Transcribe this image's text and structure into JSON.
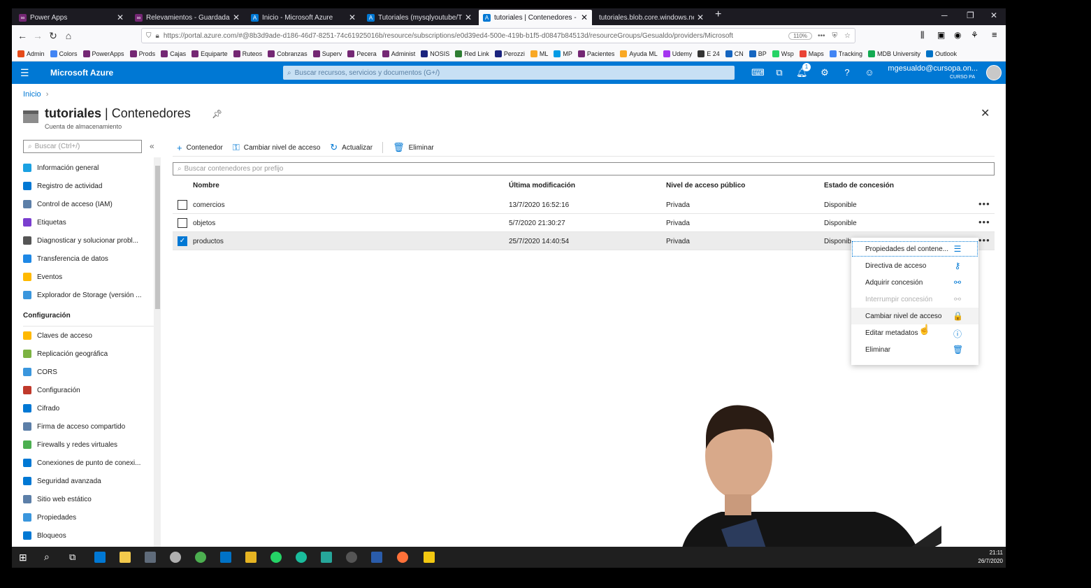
{
  "browser": {
    "tabs": [
      {
        "label": "Power Apps",
        "color": "#742774"
      },
      {
        "label": "Relevamientos - Guardada (no",
        "color": "#742774"
      },
      {
        "label": "Inicio - Microsoft Azure",
        "color": "#0078d4"
      },
      {
        "label": "Tutoriales (mysqlyoutube/Tuto",
        "color": "#0078d4"
      },
      {
        "label": "tutoriales | Contenedores - Mic",
        "color": "#0078d4"
      },
      {
        "label": "tutoriales.blob.core.windows.net/p",
        "color": "#888888"
      }
    ],
    "new_tab": "+",
    "url": "https://portal.azure.com/#@8b3d9ade-d186-46d7-8251-74c61925016b/resource/subscriptions/e0d39ed4-500e-419b-b1f5-d0847b84513d/resourceGroups/Gesualdo/providers/Microsoft",
    "zoom": "110%",
    "bookmarks": [
      {
        "label": "Admin",
        "color": "#e64a19"
      },
      {
        "label": "Colors",
        "color": "#4285f4"
      },
      {
        "label": "PowerApps",
        "color": "#742774"
      },
      {
        "label": "Prods",
        "color": "#742774"
      },
      {
        "label": "Cajas",
        "color": "#742774"
      },
      {
        "label": "Equiparte",
        "color": "#742774"
      },
      {
        "label": "Ruteos",
        "color": "#742774"
      },
      {
        "label": "Cobranzas",
        "color": "#742774"
      },
      {
        "label": "Superv",
        "color": "#742774"
      },
      {
        "label": "Pecera",
        "color": "#742774"
      },
      {
        "label": "Administ",
        "color": "#742774"
      },
      {
        "label": "NOSIS",
        "color": "#1a237e"
      },
      {
        "label": "Red Link",
        "color": "#2e7d32"
      },
      {
        "label": "Perozzi",
        "color": "#1a237e"
      },
      {
        "label": "ML",
        "color": "#f9a825"
      },
      {
        "label": "MP",
        "color": "#039be5"
      },
      {
        "label": "Pacientes",
        "color": "#742774"
      },
      {
        "label": "Ayuda ML",
        "color": "#f9a825"
      },
      {
        "label": "Udemy",
        "color": "#a435f0"
      },
      {
        "label": "E 24",
        "color": "#333333"
      },
      {
        "label": "CN",
        "color": "#1565c0"
      },
      {
        "label": "BP",
        "color": "#1565c0"
      },
      {
        "label": "Wsp",
        "color": "#25d366"
      },
      {
        "label": "Maps",
        "color": "#ea4335"
      },
      {
        "label": "Tracking",
        "color": "#4285f4"
      },
      {
        "label": "MDB University",
        "color": "#13aa52"
      },
      {
        "label": "Outlook",
        "color": "#0072c6"
      }
    ]
  },
  "azure": {
    "brand": "Microsoft Azure",
    "search_placeholder": "Buscar recursos, servicios y documentos (G+/)",
    "notification_count": "1",
    "user_email": "mgesualdo@cursopa.on...",
    "user_org": "CURSO PA"
  },
  "page": {
    "breadcrumb": "Inicio",
    "title_bold": "tutoriales",
    "title_rest": " | Contenedores",
    "subtitle": "Cuenta de almacenamiento",
    "menu_search_placeholder": "Buscar (Ctrl+/)",
    "collapse": "«"
  },
  "menu": {
    "items_top": [
      {
        "label": "Información general",
        "color": "#1ba1e2"
      },
      {
        "label": "Registro de actividad",
        "color": "#0078d4"
      },
      {
        "label": "Control de acceso (IAM)",
        "color": "#5c7fa8"
      },
      {
        "label": "Etiquetas",
        "color": "#7a3ecf"
      },
      {
        "label": "Diagnosticar y solucionar probl...",
        "color": "#555555"
      },
      {
        "label": "Transferencia de datos",
        "color": "#1e88e5"
      },
      {
        "label": "Eventos",
        "color": "#ffb900"
      },
      {
        "label": "Explorador de Storage (versión ...",
        "color": "#3a96dd"
      }
    ],
    "section": "Configuración",
    "items_config": [
      {
        "label": "Claves de acceso",
        "color": "#ffb900"
      },
      {
        "label": "Replicación geográfica",
        "color": "#7cb342"
      },
      {
        "label": "CORS",
        "color": "#3a96dd"
      },
      {
        "label": "Configuración",
        "color": "#c0392b"
      },
      {
        "label": "Cifrado",
        "color": "#0078d4"
      },
      {
        "label": "Firma de acceso compartido",
        "color": "#5c7fa8"
      },
      {
        "label": "Firewalls y redes virtuales",
        "color": "#4caf50"
      },
      {
        "label": "Conexiones de punto de conexi...",
        "color": "#0078d4"
      },
      {
        "label": "Seguridad avanzada",
        "color": "#0078d4"
      },
      {
        "label": "Sitio web estático",
        "color": "#5c7fa8"
      },
      {
        "label": "Propiedades",
        "color": "#3a96dd"
      },
      {
        "label": "Bloqueos",
        "color": "#0078d4"
      }
    ]
  },
  "toolbar": {
    "add": "Contenedor",
    "change_access": "Cambiar nivel de acceso",
    "refresh": "Actualizar",
    "delete": "Eliminar",
    "prefix_placeholder": "Buscar contenedores por prefijo"
  },
  "table": {
    "columns": [
      "Nombre",
      "Última modificación",
      "Nivel de acceso público",
      "Estado de concesión"
    ],
    "rows": [
      {
        "name": "comercios",
        "modified": "13/7/2020 16:52:16",
        "access": "Privada",
        "lease": "Disponible",
        "selected": false
      },
      {
        "name": "objetos",
        "modified": "5/7/2020 21:30:27",
        "access": "Privada",
        "lease": "Disponible",
        "selected": false
      },
      {
        "name": "productos",
        "modified": "25/7/2020 14:40:54",
        "access": "Privada",
        "lease": "Disponib",
        "selected": true
      }
    ],
    "more": "•••"
  },
  "context_menu": [
    {
      "label": "Propiedades del contene...",
      "icon": "sliders-icon",
      "glyph": "☰"
    },
    {
      "label": "Directiva de acceso",
      "icon": "key-icon",
      "glyph": "⚷"
    },
    {
      "label": "Adquirir concesión",
      "icon": "link-icon",
      "glyph": "⚯"
    },
    {
      "label": "Interrumpir concesión",
      "icon": "broken-link-icon",
      "glyph": "⚯",
      "disabled": true
    },
    {
      "label": "Cambiar nivel de acceso",
      "icon": "lock-icon",
      "glyph": "🔒"
    },
    {
      "label": "Editar metadatos",
      "icon": "info-icon",
      "glyph": "ⓘ"
    },
    {
      "label": "Eliminar",
      "icon": "trash-icon",
      "glyph": "🗑"
    }
  ],
  "taskbar": {
    "time": "21:11",
    "date": "26/7/2020"
  }
}
